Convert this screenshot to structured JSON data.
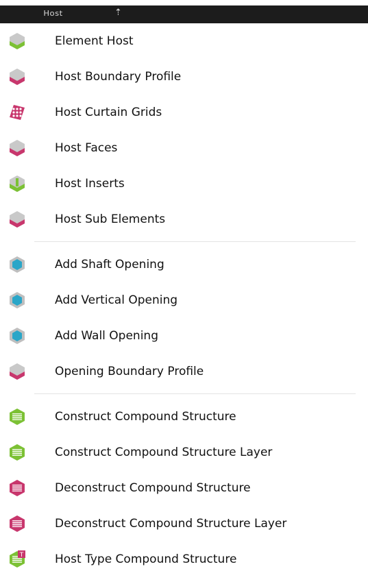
{
  "titlebar": {
    "title": "Host",
    "pin_icon": "pin-icon"
  },
  "groups": [
    [
      {
        "label": "Element Host",
        "icon": "element-host-icon",
        "color": "#7cc135"
      },
      {
        "label": "Host Boundary Profile",
        "icon": "host-boundary-profile-icon",
        "color": "#c8376d"
      },
      {
        "label": "Host Curtain Grids",
        "icon": "host-curtain-grids-icon",
        "color": "#c8376d"
      },
      {
        "label": "Host Faces",
        "icon": "host-faces-icon",
        "color": "#c8376d"
      },
      {
        "label": "Host Inserts",
        "icon": "host-inserts-icon",
        "color": "#7cc135"
      },
      {
        "label": "Host Sub Elements",
        "icon": "host-sub-elements-icon",
        "color": "#c8376d"
      }
    ],
    [
      {
        "label": "Add Shaft Opening",
        "icon": "add-shaft-opening-icon",
        "color": "#2aa6c8"
      },
      {
        "label": "Add Vertical Opening",
        "icon": "add-vertical-opening-icon",
        "color": "#2aa6c8"
      },
      {
        "label": "Add Wall Opening",
        "icon": "add-wall-opening-icon",
        "color": "#2aa6c8"
      },
      {
        "label": "Opening Boundary Profile",
        "icon": "opening-boundary-profile-icon",
        "color": "#c8376d"
      }
    ],
    [
      {
        "label": "Construct Compound Structure",
        "icon": "construct-compound-structure-icon",
        "color": "#7cc135"
      },
      {
        "label": "Construct Compound Structure Layer",
        "icon": "construct-compound-structure-layer-icon",
        "color": "#7cc135"
      },
      {
        "label": "Deconstruct Compound Structure",
        "icon": "deconstruct-compound-structure-icon",
        "color": "#c8376d"
      },
      {
        "label": "Deconstruct Compound Structure Layer",
        "icon": "deconstruct-compound-structure-layer-icon",
        "color": "#c8376d"
      },
      {
        "label": "Host Type Compound Structure",
        "icon": "host-type-compound-structure-icon",
        "color": "#7cc135",
        "badge": "T"
      }
    ]
  ]
}
